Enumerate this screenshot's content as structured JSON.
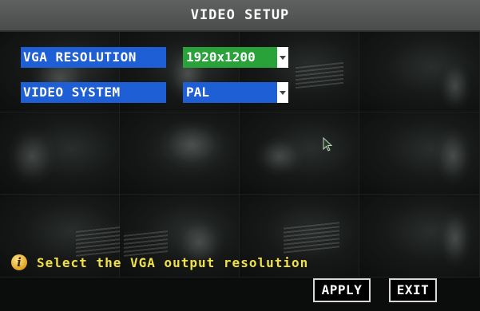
{
  "window": {
    "title": "VIDEO SETUP"
  },
  "settings": {
    "vga_resolution": {
      "label": "VGA RESOLUTION",
      "value": "1920x1200"
    },
    "video_system": {
      "label": "VIDEO SYSTEM",
      "value": "PAL"
    }
  },
  "info": {
    "icon": "info-icon",
    "glyph": "i",
    "message": "Select the VGA output resolution"
  },
  "buttons": {
    "apply": "APPLY",
    "exit": "EXIT"
  },
  "colors": {
    "label_bg": "#1f5fd6",
    "resolution_selected_bg": "#2aa23a",
    "video_system_bg": "#1f5fd6",
    "info_text": "#f0e04a"
  }
}
